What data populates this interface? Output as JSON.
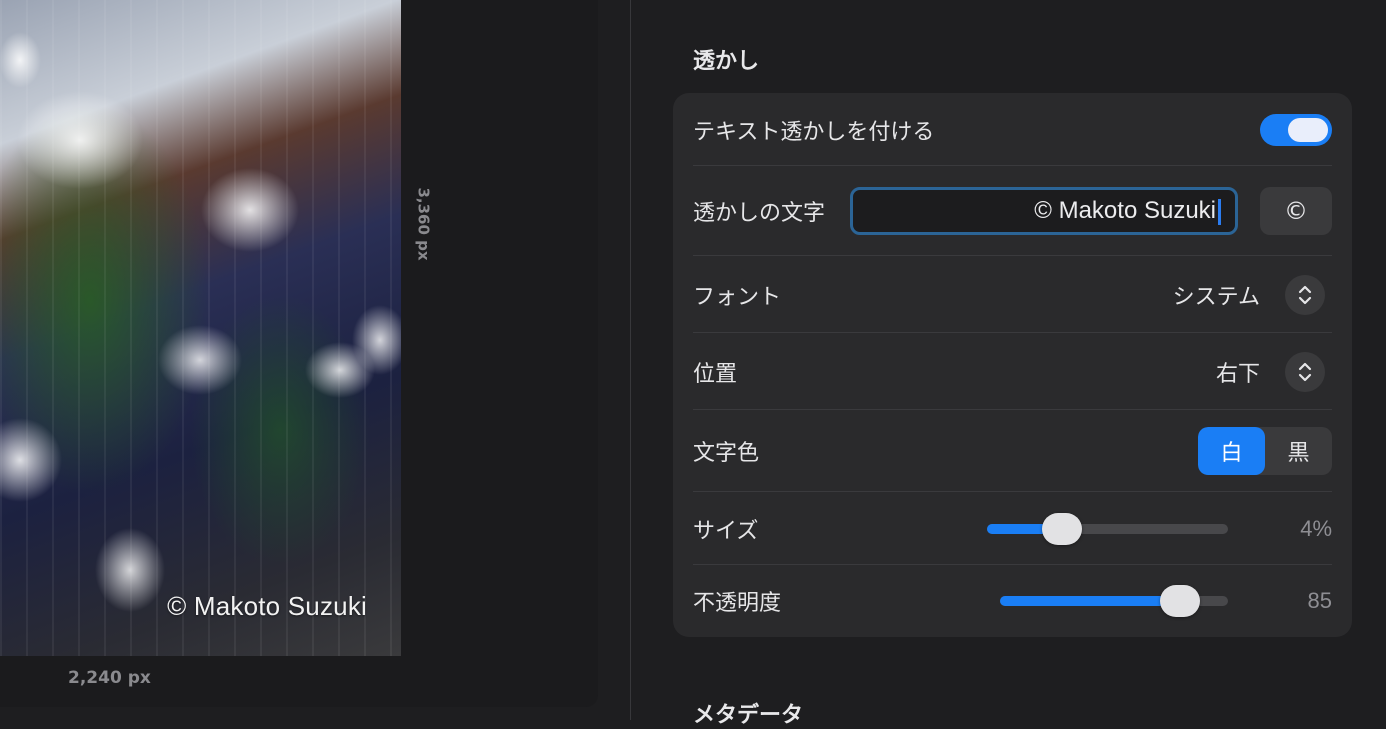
{
  "preview": {
    "watermark_text": "© Makoto Suzuki",
    "height_label": "3,360 px",
    "width_label": "2,240 px"
  },
  "watermark_section": {
    "title": "透かし",
    "add_text_watermark": {
      "label": "テキスト透かしを付ける",
      "enabled": true
    },
    "watermark_text": {
      "label": "透かしの文字",
      "value": "© Makoto Suzuki",
      "insert_button": "©"
    },
    "font": {
      "label": "フォント",
      "value": "システム"
    },
    "position": {
      "label": "位置",
      "value": "右下"
    },
    "text_color": {
      "label": "文字色",
      "options": [
        "白",
        "黒"
      ],
      "selected": "白"
    },
    "size": {
      "label": "サイズ",
      "value_label": "4%",
      "fraction": 0.31
    },
    "opacity": {
      "label": "不透明度",
      "value_label": "85",
      "fraction": 0.79
    }
  },
  "metadata_section": {
    "title": "メタデータ"
  },
  "colors": {
    "accent": "#1a7ef5",
    "card": "#2a2a2c",
    "background": "#1e1e20"
  }
}
